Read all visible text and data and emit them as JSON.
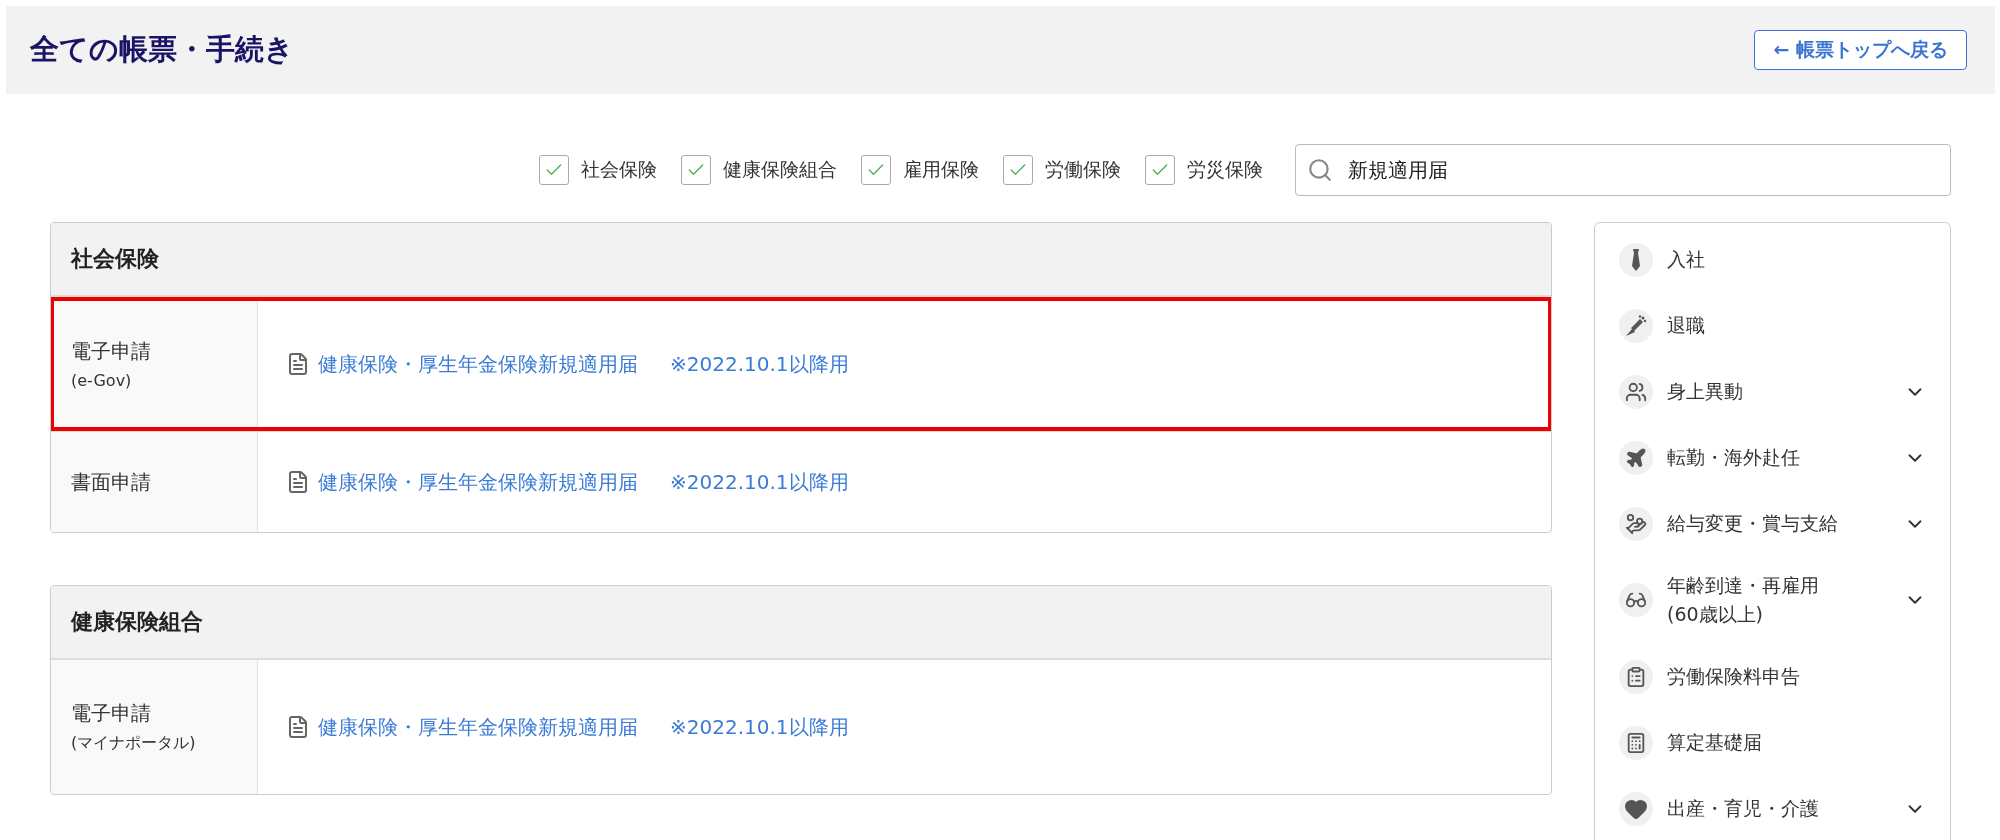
{
  "header": {
    "title": "全ての帳票・手続き",
    "back_button": "← 帳票トップへ戻る"
  },
  "filters": [
    {
      "label": "社会保険",
      "checked": true
    },
    {
      "label": "健康保険組合",
      "checked": true
    },
    {
      "label": "雇用保険",
      "checked": true
    },
    {
      "label": "労働保険",
      "checked": true
    },
    {
      "label": "労災保険",
      "checked": true
    }
  ],
  "search": {
    "value": "新規適用届"
  },
  "sections": [
    {
      "title": "社会保険",
      "rows": [
        {
          "label": "電子申請",
          "sublabel": "(e-Gov)",
          "highlighted": true,
          "link": "健康保険・厚生年金保険新規適用届",
          "note": "※2022.10.1以降用"
        },
        {
          "label": "書面申請",
          "highlighted": false,
          "link": "健康保険・厚生年金保険新規適用届",
          "note": "※2022.10.1以降用"
        }
      ]
    },
    {
      "title": "健康保険組合",
      "rows": [
        {
          "label": "電子申請",
          "sublabel": "(マイナポータル)",
          "highlighted": false,
          "link": "健康保険・厚生年金保険新規適用届",
          "note": "※2022.10.1以降用"
        }
      ]
    }
  ],
  "sidebar": {
    "items": [
      {
        "label": "入社",
        "expandable": false
      },
      {
        "label": "退職",
        "expandable": false
      },
      {
        "label": "身上異動",
        "expandable": true
      },
      {
        "label": "転勤・海外赴任",
        "expandable": true
      },
      {
        "label": "給与変更・賞与支給",
        "expandable": true
      },
      {
        "label": "年齢到達・再雇用",
        "sublabel": "(60歳以上)",
        "expandable": true
      },
      {
        "label": "労働保険料申告",
        "expandable": false
      },
      {
        "label": "算定基礎届",
        "expandable": false
      },
      {
        "label": "出産・育児・介護",
        "expandable": true
      }
    ]
  }
}
